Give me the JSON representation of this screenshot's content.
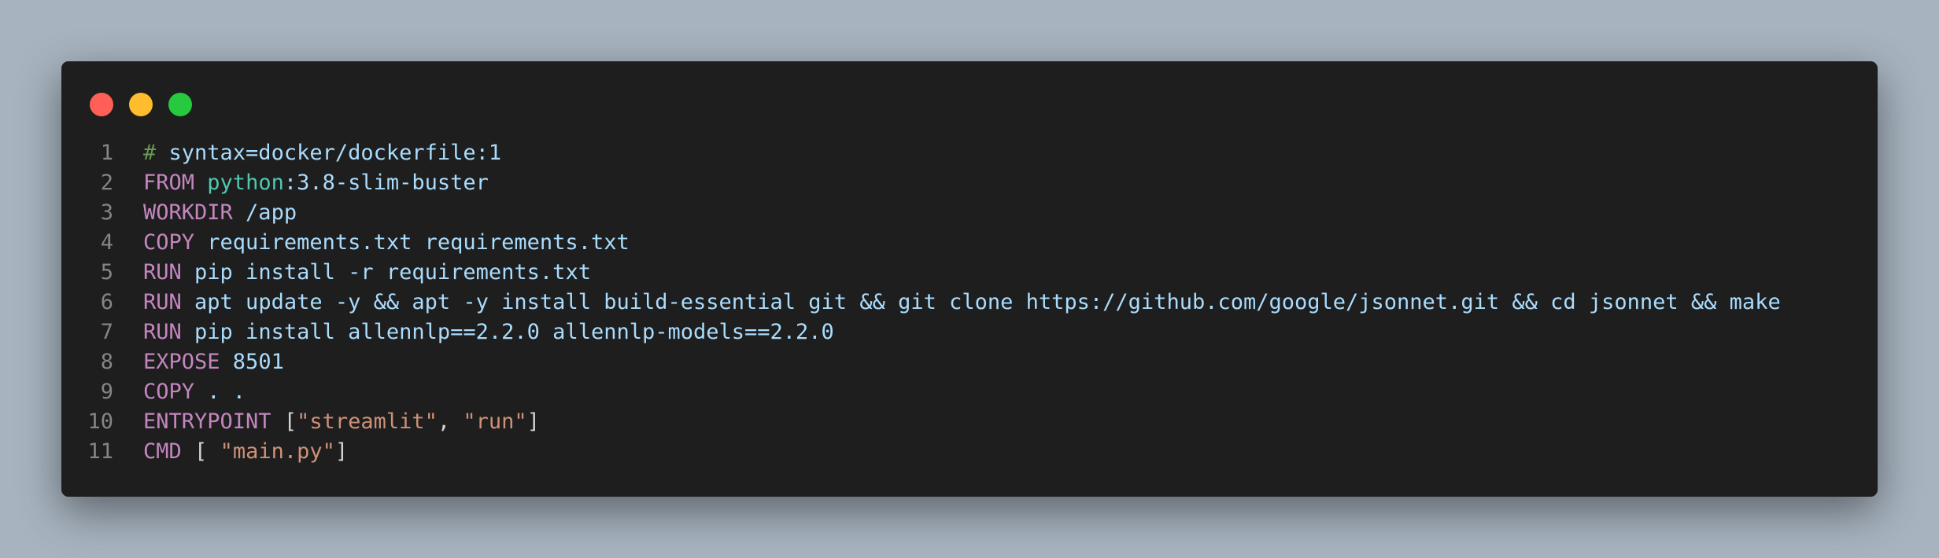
{
  "window": {
    "controls": [
      "close",
      "minimize",
      "maximize"
    ]
  },
  "code": {
    "lines": [
      {
        "n": "1",
        "tokens": [
          {
            "t": "#",
            "k": "comment"
          },
          {
            "t": " syntax=docker/dockerfile:1",
            "k": "plain"
          }
        ]
      },
      {
        "n": "2",
        "tokens": [
          {
            "t": "FROM",
            "k": "kw"
          },
          {
            "t": " ",
            "k": "plain"
          },
          {
            "t": "python",
            "k": "type"
          },
          {
            "t": ":3.8-slim-buster",
            "k": "plain"
          }
        ]
      },
      {
        "n": "3",
        "tokens": [
          {
            "t": "WORKDIR",
            "k": "kw"
          },
          {
            "t": " /app",
            "k": "plain"
          }
        ]
      },
      {
        "n": "4",
        "tokens": [
          {
            "t": "COPY",
            "k": "kw"
          },
          {
            "t": " requirements.txt requirements.txt",
            "k": "plain"
          }
        ]
      },
      {
        "n": "5",
        "tokens": [
          {
            "t": "RUN",
            "k": "kw"
          },
          {
            "t": " pip install -r requirements.txt",
            "k": "plain"
          }
        ]
      },
      {
        "n": "6",
        "tokens": [
          {
            "t": "RUN",
            "k": "kw"
          },
          {
            "t": " apt update -y && apt -y install build-essential git && git clone https://github.com/google/jsonnet.git && cd jsonnet && make",
            "k": "plain"
          }
        ]
      },
      {
        "n": "7",
        "tokens": [
          {
            "t": "RUN",
            "k": "kw"
          },
          {
            "t": " pip install allennlp==2.2.0 allennlp-models==2.2.0",
            "k": "plain"
          }
        ]
      },
      {
        "n": "8",
        "tokens": [
          {
            "t": "EXPOSE",
            "k": "kw"
          },
          {
            "t": " 8501",
            "k": "plain"
          }
        ]
      },
      {
        "n": "9",
        "tokens": [
          {
            "t": "COPY",
            "k": "kw"
          },
          {
            "t": " . .",
            "k": "plain"
          }
        ]
      },
      {
        "n": "10",
        "tokens": [
          {
            "t": "ENTRYPOINT",
            "k": "kw"
          },
          {
            "t": " [",
            "k": "punct"
          },
          {
            "t": "\"streamlit\"",
            "k": "str"
          },
          {
            "t": ", ",
            "k": "punct"
          },
          {
            "t": "\"run\"",
            "k": "str"
          },
          {
            "t": "]",
            "k": "punct"
          }
        ]
      },
      {
        "n": "11",
        "tokens": [
          {
            "t": "CMD",
            "k": "kw"
          },
          {
            "t": " [ ",
            "k": "punct"
          },
          {
            "t": "\"main.py\"",
            "k": "str"
          },
          {
            "t": "]",
            "k": "punct"
          }
        ]
      }
    ]
  },
  "colors": {
    "background": "#a7b3bf",
    "window": "#1e1e1e",
    "close": "#ff5f56",
    "minimize": "#ffbd2e",
    "maximize": "#27c93f",
    "keyword": "#c586c0",
    "comment": "#6a9955",
    "type": "#4ec9b0",
    "string": "#ce9178",
    "text": "#a9dcfd",
    "line_number": "#858585"
  }
}
